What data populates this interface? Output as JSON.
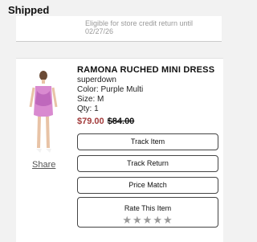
{
  "section": {
    "title": "Shipped"
  },
  "previous_item": {
    "line1": "Eligible for store credit return until",
    "line2": "02/27/26"
  },
  "product": {
    "name": "RAMONA RUCHED MINI DRESS",
    "brand": "superdown",
    "color": "Color: Purple Multi",
    "size": "Size: M",
    "qty": "Qty: 1",
    "price_sale": "$79.00",
    "price_original": "$84.00",
    "share_label": "Share",
    "image_icon": "product-photo"
  },
  "actions": {
    "track_item": "Track Item",
    "track_return": "Track Return",
    "price_match": "Price Match",
    "rate_label": "Rate This Item",
    "stars": "★★★★★"
  },
  "colors": {
    "sale_price": "#a23b3b",
    "dress_pink": "#d98ad0",
    "dress_purple": "#b85fb7"
  }
}
